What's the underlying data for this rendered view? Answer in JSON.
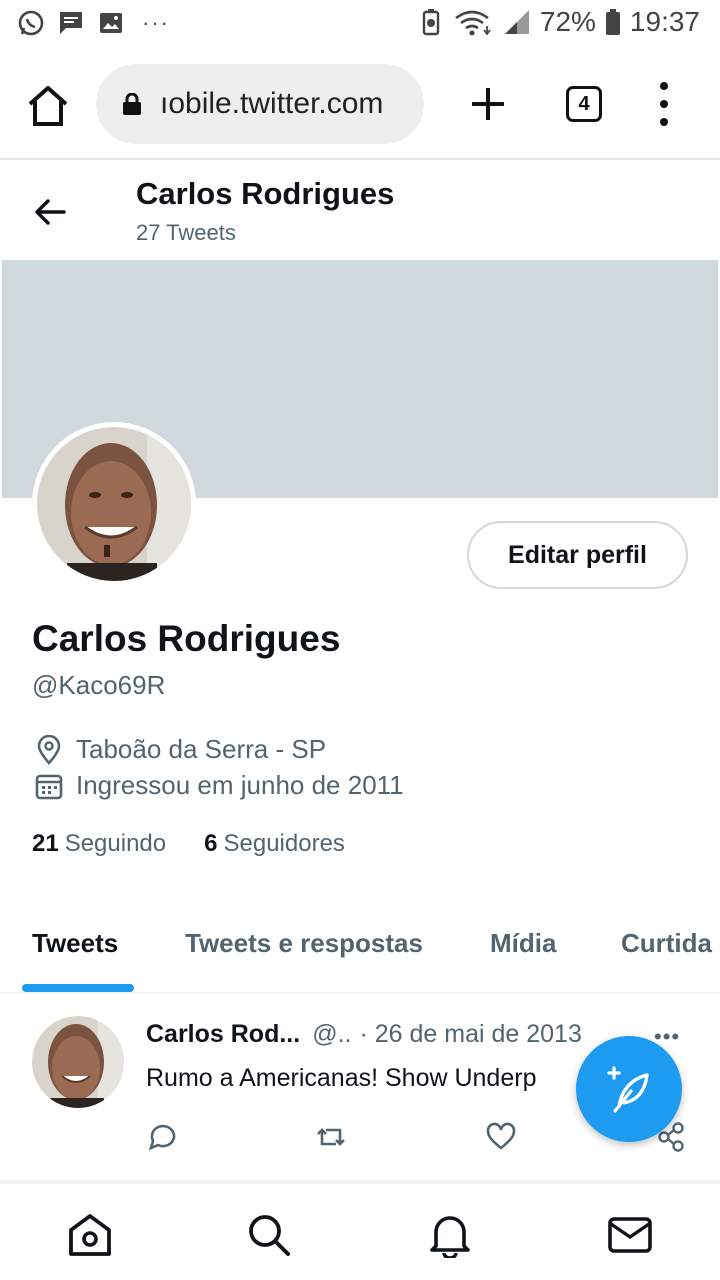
{
  "status_bar": {
    "battery": "72%",
    "time": "19:37",
    "overflow": "···"
  },
  "browser": {
    "url": "ıobile.twitter.com",
    "tab_count": "4"
  },
  "profile_header": {
    "name": "Carlos Rodrigues",
    "tweet_count": "27 Tweets"
  },
  "profile": {
    "edit_button": "Editar perfil",
    "display_name": "Carlos Rodrigues",
    "handle": "@Kaco69R",
    "location": "Taboão da Serra - SP",
    "joined": "Ingressou em junho de 2011",
    "following_count": "21",
    "following_label": "Seguindo",
    "followers_count": "6",
    "followers_label": "Seguidores"
  },
  "tabs": [
    {
      "label": "Tweets",
      "active": true
    },
    {
      "label": "Tweets e respostas",
      "active": false
    },
    {
      "label": "Mídia",
      "active": false
    },
    {
      "label": "Curtida",
      "active": false
    }
  ],
  "tweet": {
    "name": "Carlos Rod...",
    "handle": "@..",
    "date": "· 26 de mai de 2013",
    "more": "•••",
    "text": "Rumo a Americanas! Show Underp"
  },
  "colors": {
    "accent": "#1d9bf0",
    "banner": "#cfd9de",
    "secondary_text": "#536471"
  }
}
